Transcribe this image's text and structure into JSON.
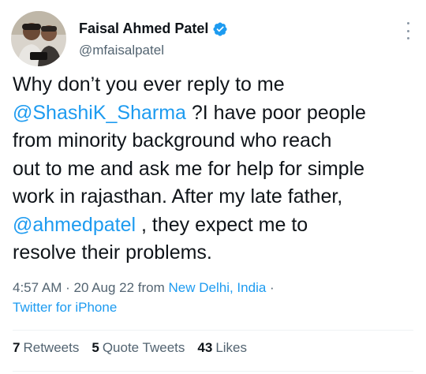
{
  "author": {
    "name": "Faisal Ahmed Patel",
    "handle": "@mfaisalpatel"
  },
  "tweet": {
    "line1": "Why don’t you ever reply to me",
    "mention1": "@ShashiK_Sharma",
    "line2_rest": " ?I have poor people",
    "line3": "from minority background who reach",
    "line4": "out to me and ask me for help for simple",
    "line5": "work in rajasthan. After my late father,",
    "mention2": "@ahmedpatel",
    "line6_rest": " , they expect me to",
    "line7": "resolve their problems."
  },
  "meta": {
    "time": "4:57 AM",
    "sep1": " · ",
    "date": "20 Aug 22",
    "from_label": " from ",
    "location": "New Delhi, India",
    "sep2": " ·",
    "source": "Twitter for iPhone"
  },
  "stats": {
    "retweets_count": "7",
    "retweets_label": "Retweets",
    "quotes_count": "5",
    "quotes_label": "Quote Tweets",
    "likes_count": "43",
    "likes_label": "Likes"
  },
  "colors": {
    "accent": "#1d9bf0",
    "text": "#0f1419",
    "secondary": "#536471"
  }
}
